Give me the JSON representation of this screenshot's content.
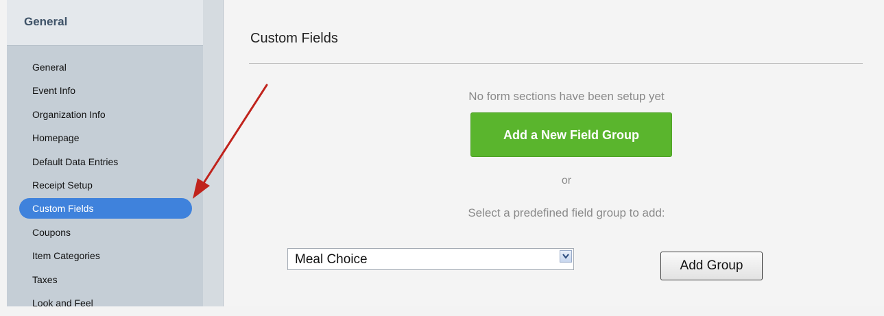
{
  "sidebar": {
    "header": "General",
    "items": [
      {
        "label": "General",
        "active": false
      },
      {
        "label": "Event Info",
        "active": false
      },
      {
        "label": "Organization Info",
        "active": false
      },
      {
        "label": "Homepage",
        "active": false
      },
      {
        "label": "Default Data Entries",
        "active": false
      },
      {
        "label": "Receipt Setup",
        "active": false
      },
      {
        "label": "Custom Fields",
        "active": true
      },
      {
        "label": "Coupons",
        "active": false
      },
      {
        "label": "Item Categories",
        "active": false
      },
      {
        "label": "Taxes",
        "active": false
      },
      {
        "label": "Look and Feel",
        "active": false
      }
    ]
  },
  "main": {
    "title": "Custom Fields",
    "empty_message": "No form sections have been setup yet",
    "add_field_group_label": "Add a New Field Group",
    "or_text": "or",
    "predefined_label": "Select a predefined field group to add:",
    "select": {
      "value": "Meal Choice"
    },
    "add_group_label": "Add Group"
  },
  "icons": {
    "select_arrow": "chevron-down-icon",
    "annotation": "red-arrow-annotation"
  },
  "colors": {
    "sidebar_bg": "#c5ced6",
    "active_item_bg": "#3f82dc",
    "primary_button": "#5ab52d",
    "annotation_arrow": "#c0231c"
  }
}
